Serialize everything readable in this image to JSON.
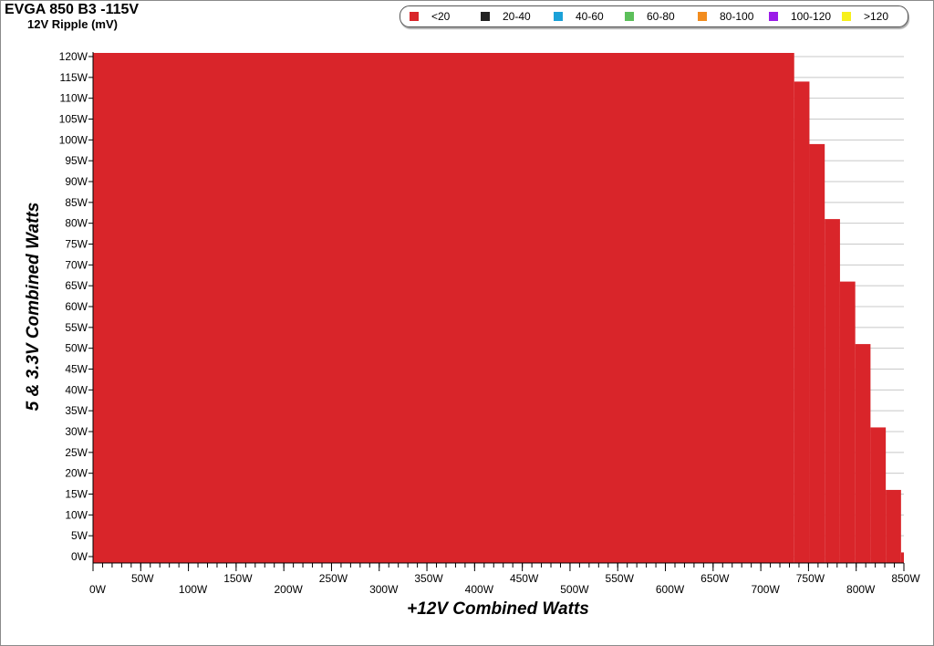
{
  "header": {
    "title": "EVGA 850 B3 -115V",
    "subtitle": "12V Ripple (mV)"
  },
  "chart_data": {
    "type": "area",
    "title": "EVGA 850 B3 -115V",
    "subtitle": "12V Ripple (mV)",
    "xlabel": "+12V Combined Watts",
    "ylabel": "5 & 3.3V Combined Watts",
    "xlim": [
      0,
      850
    ],
    "ylim": [
      0,
      120
    ],
    "x_ticks": [
      "0W",
      "50W",
      "100W",
      "150W",
      "200W",
      "250W",
      "300W",
      "350W",
      "400W",
      "450W",
      "500W",
      "550W",
      "600W",
      "650W",
      "700W",
      "750W",
      "800W",
      "850W"
    ],
    "y_ticks": [
      "0W",
      "5W",
      "10W",
      "15W",
      "20W",
      "25W",
      "30W",
      "35W",
      "40W",
      "45W",
      "50W",
      "55W",
      "60W",
      "65W",
      "70W",
      "75W",
      "80W",
      "85W",
      "90W",
      "95W",
      "100W",
      "105W",
      "110W",
      "115W",
      "120W"
    ],
    "grid": true,
    "legend_position": "top",
    "legend": [
      {
        "label": "<20",
        "color": "#d9252a"
      },
      {
        "label": "20-40",
        "color": "#222222"
      },
      {
        "label": "40-60",
        "color": "#1ba1d8"
      },
      {
        "label": "60-80",
        "color": "#5cbf5a"
      },
      {
        "label": "80-100",
        "color": "#f28c1e"
      },
      {
        "label": "100-120",
        "color": "#9b1ce8"
      },
      {
        "label": ">120",
        "color": "#f7f01b"
      }
    ],
    "series": [
      {
        "name": "<20",
        "color": "#d9252a",
        "steps": [
          {
            "x_end": 735,
            "y_top": 121
          },
          {
            "x_end": 751,
            "y_top": 114
          },
          {
            "x_end": 767,
            "y_top": 99
          },
          {
            "x_end": 783,
            "y_top": 81
          },
          {
            "x_end": 799,
            "y_top": 66
          },
          {
            "x_end": 815,
            "y_top": 51
          },
          {
            "x_end": 831,
            "y_top": 31
          },
          {
            "x_end": 847,
            "y_top": 16
          },
          {
            "x_end": 862,
            "y_top": 1
          }
        ]
      }
    ]
  }
}
